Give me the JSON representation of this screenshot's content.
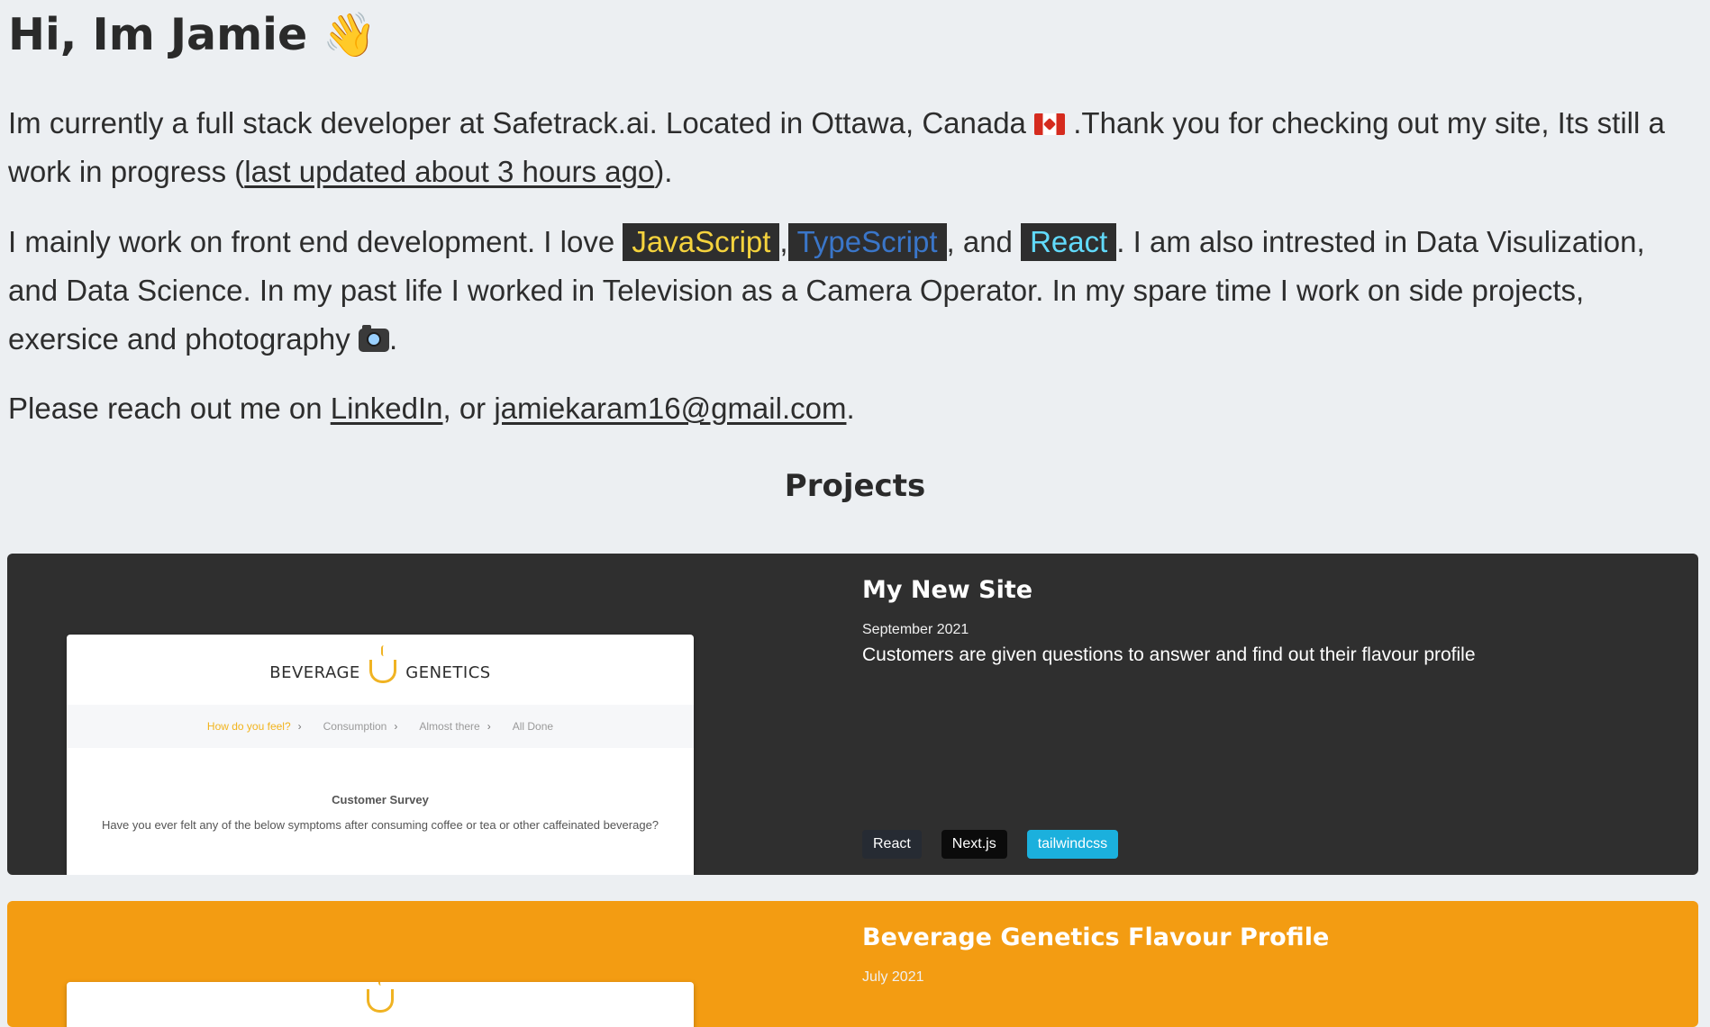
{
  "hero": {
    "title": "Hi, Im Jamie",
    "wave_emoji": "👋"
  },
  "intro": {
    "text_before_flag": "Im currently a full stack developer at Safetrack.ai. Located in Ottawa, Canada",
    "flag_icon": "canada-flag-icon",
    "text_after_flag": ".Thank you for checking out my site, Its still a work in progress (",
    "last_updated_link": "last updated about 3 hours ago",
    "text_end": ")."
  },
  "skills": {
    "text_start": "I mainly work on front end development. I love",
    "js": "JavaScript",
    "comma": ",",
    "ts": "TypeScript",
    "and": ", and",
    "react": "React",
    "text_rest": ". I am also intrested in Data Visulization, and Data Science. In my past life I worked in Television as a Camera Operator. In my spare time I work on side projects, exersice and photography",
    "camera_icon": "camera-icon",
    "period": "."
  },
  "contact": {
    "text_start": "Please reach out me on",
    "linkedin": "LinkedIn",
    "or": ", or",
    "email": "jamiekaram16@gmail.com",
    "period": "."
  },
  "projects": {
    "heading": "Projects",
    "items": [
      {
        "title": "My New Site",
        "date": "September 2021",
        "description": "Customers are given questions to answer and find out their flavour profile",
        "tags": [
          "React",
          "Next.js",
          "tailwindcss"
        ],
        "preview": {
          "brand_left": "BEVERAGE",
          "brand_right": "GENETICS",
          "steps": [
            "How do you feel?",
            "Consumption",
            "Almost there",
            "All Done"
          ],
          "survey_title": "Customer Survey",
          "survey_question": "Have you ever felt any of the below symptoms after consuming coffee or tea or other caffeinated beverage?"
        }
      },
      {
        "title": "Beverage Genetics Flavour Profile",
        "date": "July 2021"
      }
    ]
  },
  "colors": {
    "background": "#eceff2",
    "card_dark": "#2f2f2f",
    "card_orange": "#f39c12",
    "js": "#f5d33d",
    "ts": "#3a76c9",
    "react": "#61dafb",
    "tailwind_tag": "#1bb0dd"
  }
}
